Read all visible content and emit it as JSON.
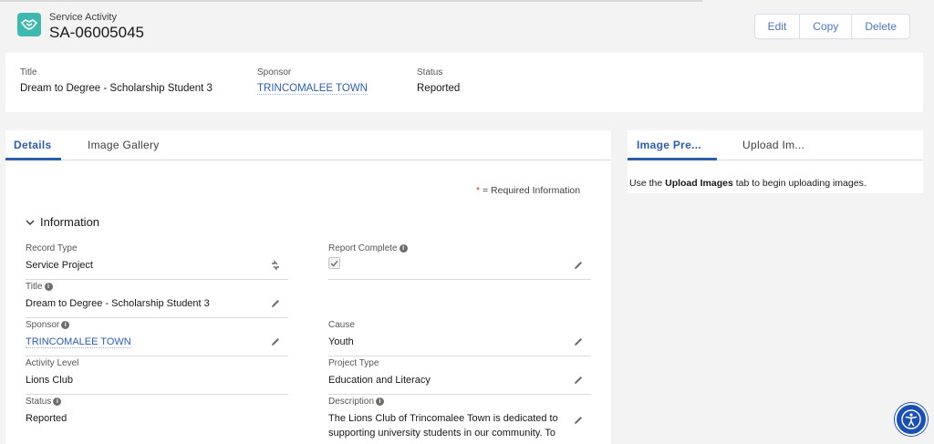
{
  "header": {
    "object_type": "Service Activity",
    "record_name": "SA-06005045",
    "buttons": {
      "edit": "Edit",
      "copy": "Copy",
      "delete": "Delete"
    },
    "icon": "handshake-icon",
    "icon_color": "#3fb8af"
  },
  "highlights": {
    "title_label": "Title",
    "title_value": "Dream to Degree - Scholarship Student 3",
    "sponsor_label": "Sponsor",
    "sponsor_value": "TRINCOMALEE TOWN",
    "status_label": "Status",
    "status_value": "Reported"
  },
  "main_tabs": {
    "details": "Details",
    "gallery": "Image Gallery"
  },
  "required_note": {
    "star": "*",
    "text": " = Required Information"
  },
  "section": {
    "title": "Information"
  },
  "fields": {
    "record_type": {
      "label": "Record Type",
      "value": "Service Project"
    },
    "report_complete": {
      "label": "Report Complete",
      "checked": true
    },
    "title": {
      "label": "Title",
      "value": "Dream to Degree - Scholarship Student 3"
    },
    "sponsor": {
      "label": "Sponsor",
      "value": "TRINCOMALEE TOWN"
    },
    "cause": {
      "label": "Cause",
      "value": "Youth"
    },
    "activity_level": {
      "label": "Activity Level",
      "value": "Lions Club"
    },
    "project_type": {
      "label": "Project Type",
      "value": "Education and Literacy"
    },
    "status": {
      "label": "Status",
      "value": "Reported"
    },
    "description": {
      "label": "Description",
      "value": "The Lions Club of Trincomalee Town is dedicated to supporting university students in our community. To"
    }
  },
  "side": {
    "tabs": {
      "preview": "Image Pre...",
      "upload": "Upload Im..."
    },
    "message_prefix": "Use the ",
    "message_bold": "Upload Images",
    "message_suffix": " tab to begin uploading images."
  },
  "colors": {
    "accent": "#2e5ea7",
    "a11y": "#1c4fb4"
  }
}
